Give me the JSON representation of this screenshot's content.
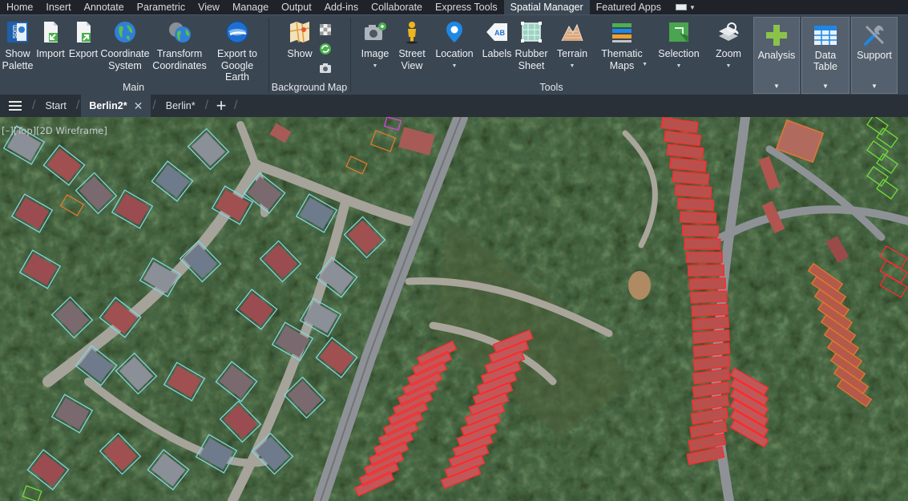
{
  "menu": {
    "tabs": [
      "Home",
      "Insert",
      "Annotate",
      "Parametric",
      "View",
      "Manage",
      "Output",
      "Add-ins",
      "Collaborate",
      "Express Tools",
      "Spatial Manager",
      "Featured Apps"
    ],
    "active_tab": "Spatial Manager"
  },
  "ribbon": {
    "main": {
      "label": "Main",
      "show_palette": "Show\nPalette",
      "import": "Import",
      "export": "Export",
      "coordinate_system": "Coordinate\nSystem",
      "transform_coordinates": "Transform\nCoordinates",
      "export_google_earth": "Export to\nGoogle Earth"
    },
    "background_map": {
      "label": "Background Map",
      "show": "Show"
    },
    "tools": {
      "label": "Tools",
      "image": "Image",
      "street_view": "Street\nView",
      "location": "Location",
      "labels": "Labels",
      "rubber_sheet": "Rubber\nSheet",
      "terrain": "Terrain",
      "thematic_maps": "Thematic\nMaps",
      "selection": "Selection",
      "zoom": "Zoom"
    },
    "panels": {
      "analysis": "Analysis",
      "data_table": "Data Table",
      "support": "Support"
    },
    "icons": {
      "spm_logo_text": "spm",
      "labels_icon_text": "AB"
    }
  },
  "doc_tabs": {
    "start": "Start",
    "berlin2": "Berlin2*",
    "berlin": "Berlin*",
    "close_glyph": "✕",
    "add_glyph": "+"
  },
  "viewport": {
    "label": "[–][Top][2D Wireframe]"
  },
  "colors": {
    "ribbon_bg": "#3b4653",
    "menubar_bg": "#1f2329",
    "outline_red": "#ff2a2a",
    "outline_cyan": "#7fd6e6",
    "outline_orange": "#e07a2a",
    "outline_green": "#6fdc3a",
    "outline_magenta": "#e040e0"
  }
}
